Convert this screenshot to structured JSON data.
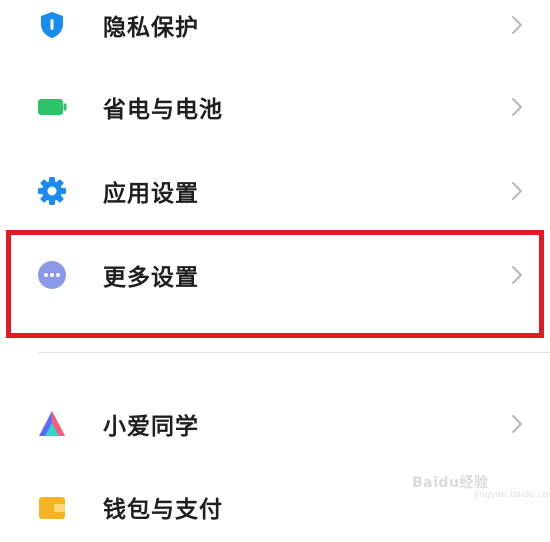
{
  "settings_list": {
    "items": [
      {
        "id": "privacy",
        "label": "隐私保护",
        "icon": "privacy-shield-icon",
        "color": "#1a8cf0"
      },
      {
        "id": "battery",
        "label": "省电与电池",
        "icon": "battery-icon",
        "color": "#2dc36b"
      },
      {
        "id": "apps",
        "label": "应用设置",
        "icon": "gear-icon",
        "color": "#1a8cf0"
      },
      {
        "id": "more",
        "label": "更多设置",
        "icon": "more-dots-icon",
        "color": "#8a99e8"
      },
      {
        "id": "xiaoai",
        "label": "小爱同学",
        "icon": "xiaoai-icon",
        "color": "#5a6cff"
      },
      {
        "id": "wallet",
        "label": "钱包与支付",
        "icon": "wallet-icon",
        "color": "#f5b324"
      }
    ]
  },
  "highlight": {
    "target": "more",
    "color": "#e21a24"
  },
  "watermark": {
    "text": "Baidu经验",
    "sub": "jingyan.baidu.com"
  }
}
